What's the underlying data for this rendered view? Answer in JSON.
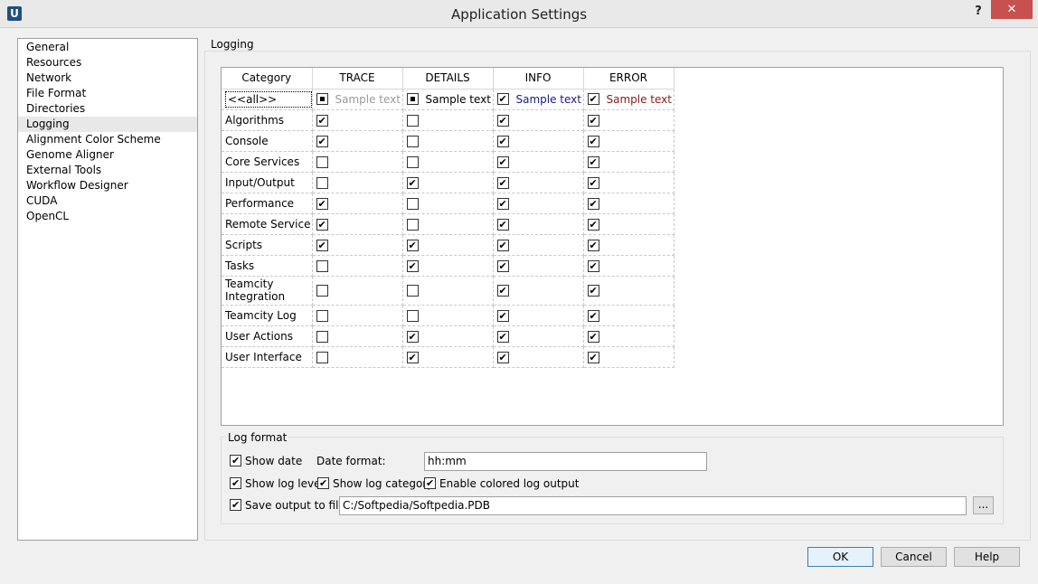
{
  "window": {
    "title": "Application Settings",
    "app_icon": "U",
    "help": "?",
    "close": "✕"
  },
  "nav": {
    "items": [
      "General",
      "Resources",
      "Network",
      "File Format",
      "Directories",
      "Logging",
      "Alignment Color Scheme",
      "Genome Aligner",
      "External Tools",
      "Workflow Designer",
      "CUDA",
      "OpenCL"
    ],
    "selected": "Logging"
  },
  "logging": {
    "group_title": "Logging",
    "columns": [
      "Category",
      "TRACE",
      "DETAILS",
      "INFO",
      "ERROR"
    ],
    "all_row": {
      "label": "<<all>>",
      "states": [
        "partial",
        "partial",
        "checked",
        "checked"
      ],
      "samples": [
        "Sample text",
        "Sample text",
        "Sample text",
        "Sample text"
      ],
      "sample_colors": [
        "#9a9a9a",
        "#000000",
        "#1a1a8c",
        "#8b1a1a"
      ]
    },
    "rows": [
      {
        "category": "Algorithms",
        "values": [
          true,
          false,
          true,
          true
        ]
      },
      {
        "category": "Console",
        "values": [
          true,
          false,
          true,
          true
        ]
      },
      {
        "category": "Core Services",
        "values": [
          false,
          false,
          true,
          true
        ]
      },
      {
        "category": "Input/Output",
        "values": [
          false,
          true,
          true,
          true
        ]
      },
      {
        "category": "Performance",
        "values": [
          true,
          false,
          true,
          true
        ]
      },
      {
        "category": "Remote Service",
        "values": [
          true,
          false,
          true,
          true
        ]
      },
      {
        "category": "Scripts",
        "values": [
          true,
          true,
          true,
          true
        ]
      },
      {
        "category": "Tasks",
        "values": [
          false,
          true,
          true,
          true
        ]
      },
      {
        "category": "Teamcity Integration",
        "values": [
          false,
          false,
          true,
          true
        ]
      },
      {
        "category": "Teamcity Log",
        "values": [
          false,
          false,
          true,
          true
        ]
      },
      {
        "category": "User Actions",
        "values": [
          false,
          true,
          true,
          true
        ]
      },
      {
        "category": "User Interface",
        "values": [
          false,
          true,
          true,
          true
        ]
      }
    ]
  },
  "log_format": {
    "group_title": "Log format",
    "show_date": {
      "label": "Show date",
      "checked": true
    },
    "date_format": {
      "label": "Date format:",
      "value": "hh:mm"
    },
    "show_log_level": {
      "label": "Show log level",
      "checked": true
    },
    "show_log_category": {
      "label": "Show log category",
      "checked": true
    },
    "enable_colored": {
      "label": "Enable colored log output",
      "checked": true
    },
    "save_output": {
      "label": "Save output to file:",
      "checked": true,
      "path": "C:/Softpedia/Softpedia.PDB",
      "browse": "..."
    }
  },
  "buttons": {
    "ok": "OK",
    "cancel": "Cancel",
    "help": "Help"
  }
}
